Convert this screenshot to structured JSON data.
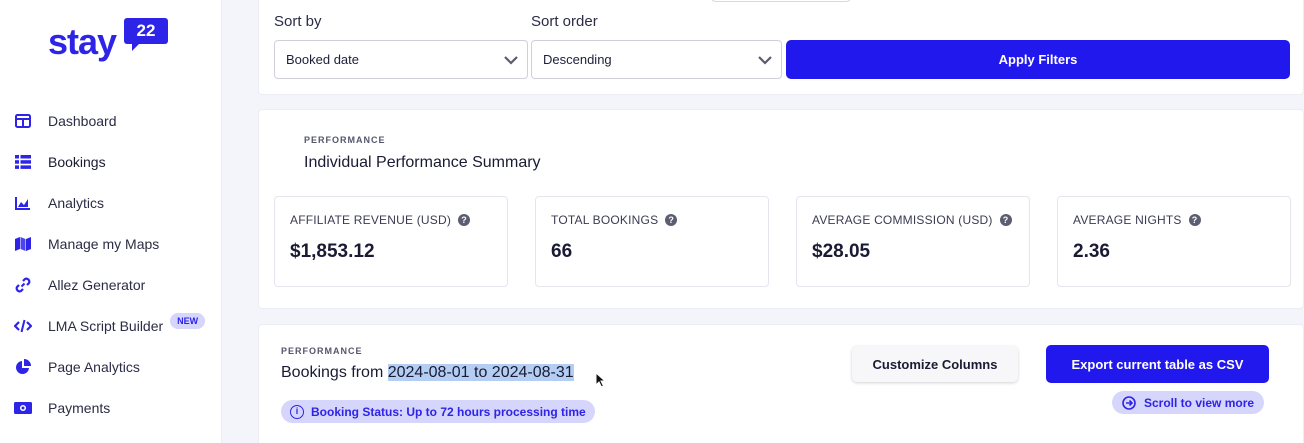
{
  "brand": {
    "name": "stay",
    "badge": "22",
    "color": "#2d24e8"
  },
  "sidebar": {
    "items": [
      {
        "label": "Dashboard",
        "icon": "dashboard-icon"
      },
      {
        "label": "Bookings",
        "icon": "list-icon"
      },
      {
        "label": "Analytics",
        "icon": "chart-icon"
      },
      {
        "label": "Manage my Maps",
        "icon": "map-icon"
      },
      {
        "label": "Allez Generator",
        "icon": "link-icon"
      },
      {
        "label": "LMA Script Builder",
        "icon": "code-icon",
        "badge": "NEW"
      },
      {
        "label": "Page Analytics",
        "icon": "pie-icon"
      },
      {
        "label": "Payments",
        "icon": "money-icon"
      }
    ]
  },
  "filters": {
    "sort_by_label": "Sort by",
    "sort_by_value": "Booked date",
    "sort_order_label": "Sort order",
    "sort_order_value": "Descending",
    "apply_label": "Apply Filters"
  },
  "summary": {
    "eyebrow": "PERFORMANCE",
    "title": "Individual Performance Summary",
    "stats": [
      {
        "label": "AFFILIATE REVENUE (USD)",
        "value": "$1,853.12"
      },
      {
        "label": "TOTAL BOOKINGS",
        "value": "66"
      },
      {
        "label": "AVERAGE COMMISSION (USD)",
        "value": "$28.05"
      },
      {
        "label": "AVERAGE NIGHTS",
        "value": "2.36"
      }
    ]
  },
  "bookings": {
    "eyebrow": "PERFORMANCE",
    "title_prefix": "Bookings from ",
    "title_range": "2024-08-01 to 2024-08-31",
    "status_pill": "Booking Status: Up to 72 hours processing time",
    "customize_label": "Customize Columns",
    "export_label": "Export current table as CSV",
    "scroll_label": "Scroll to view more"
  }
}
